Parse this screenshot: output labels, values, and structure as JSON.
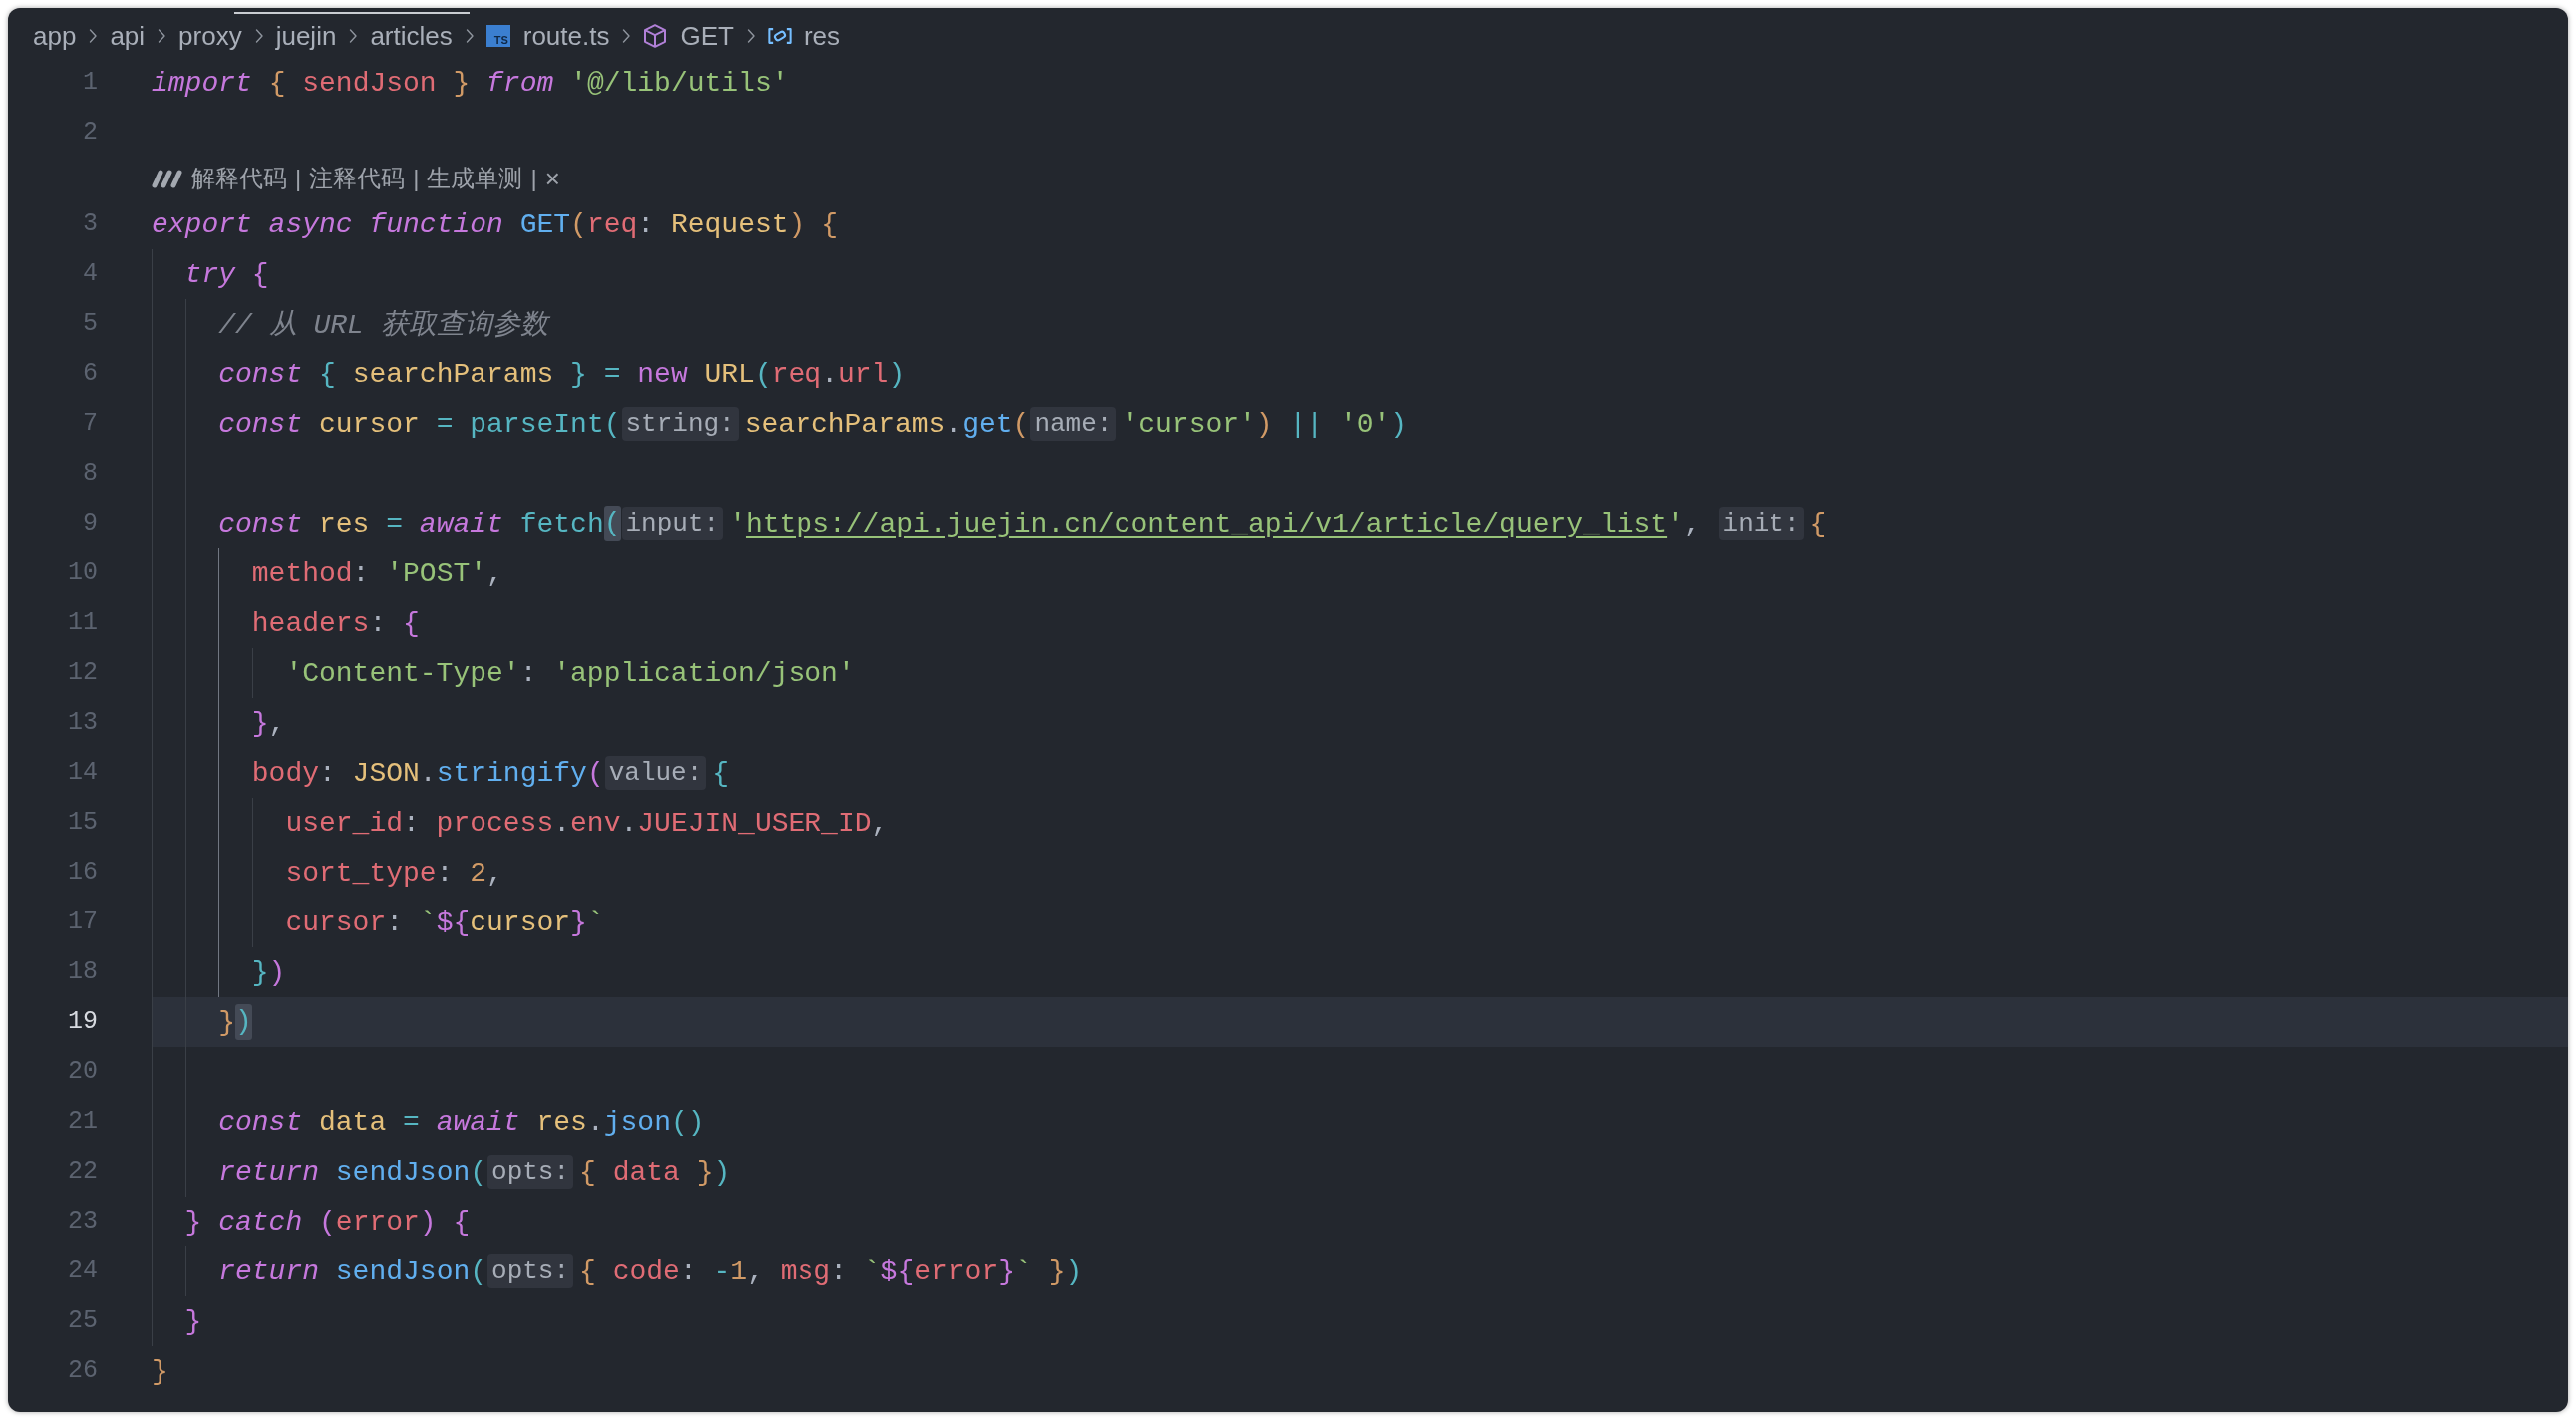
{
  "breadcrumb": [
    {
      "label": "app",
      "kind": "folder"
    },
    {
      "label": "api",
      "kind": "folder"
    },
    {
      "label": "proxy",
      "kind": "folder"
    },
    {
      "label": "juejin",
      "kind": "folder"
    },
    {
      "label": "articles",
      "kind": "folder"
    },
    {
      "label": "route.ts",
      "kind": "file",
      "icon_text": "TS"
    },
    {
      "label": "GET",
      "kind": "function"
    },
    {
      "label": "res",
      "kind": "variable"
    }
  ],
  "editor": {
    "lines": [
      {
        "kind": "code",
        "number": "1",
        "active": false,
        "tokens": [
          {
            "text": "import ",
            "kind": "keyword"
          },
          {
            "text": "{ ",
            "kind": "brace1"
          },
          {
            "text": "sendJson",
            "kind": "variable"
          },
          {
            "text": " }",
            "kind": "brace1"
          },
          {
            "text": " from ",
            "kind": "keyword"
          },
          {
            "text": "'@/lib/utils'",
            "kind": "string"
          }
        ]
      },
      {
        "kind": "code",
        "number": "2",
        "active": false
      },
      {
        "kind": "codelens",
        "items": [
          {
            "kind": "action",
            "text": "解释代码"
          },
          {
            "kind": "separator",
            "text": "|"
          },
          {
            "kind": "action",
            "text": "注释代码"
          },
          {
            "kind": "separator",
            "text": "|"
          },
          {
            "kind": "action",
            "text": "生成单测"
          },
          {
            "kind": "separator",
            "text": "|"
          },
          {
            "kind": "close",
            "text": "×"
          }
        ]
      },
      {
        "kind": "code",
        "number": "3",
        "active": false,
        "tokens": [
          {
            "text": "export async function ",
            "kind": "keyword"
          },
          {
            "text": "GET",
            "kind": "function"
          },
          {
            "text": "(",
            "kind": "brace1"
          },
          {
            "text": "req",
            "kind": "variable"
          },
          {
            "text": ": ",
            "kind": "plain"
          },
          {
            "text": "Request",
            "kind": "type"
          },
          {
            "text": ")",
            "kind": "brace1"
          },
          {
            "text": " {",
            "kind": "brace1"
          }
        ]
      },
      {
        "kind": "code",
        "number": "4",
        "active": false,
        "guides": [
          {
            "active": false
          }
        ],
        "tokens": [
          {
            "text": "try ",
            "kind": "keyword"
          },
          {
            "text": "{",
            "kind": "brace2"
          }
        ]
      },
      {
        "kind": "code",
        "number": "5",
        "active": false,
        "guides": [
          {
            "active": false
          },
          {
            "active": false
          }
        ],
        "tokens": [
          {
            "text": "// 从 URL 获取查询参数",
            "kind": "comment"
          }
        ]
      },
      {
        "kind": "code",
        "number": "6",
        "active": false,
        "guides": [
          {
            "active": false
          },
          {
            "active": false
          }
        ],
        "tokens": [
          {
            "text": "const ",
            "kind": "keyword"
          },
          {
            "text": "{ ",
            "kind": "brace3"
          },
          {
            "text": "searchParams",
            "kind": "type"
          },
          {
            "text": " }",
            "kind": "brace3"
          },
          {
            "text": " = ",
            "kind": "operator"
          },
          {
            "text": "new ",
            "kind": "storage"
          },
          {
            "text": "URL",
            "kind": "type"
          },
          {
            "text": "(",
            "kind": "brace3"
          },
          {
            "text": "req",
            "kind": "variable"
          },
          {
            "text": ".",
            "kind": "plain"
          },
          {
            "text": "url",
            "kind": "variable"
          },
          {
            "text": ")",
            "kind": "brace3"
          }
        ]
      },
      {
        "kind": "code",
        "number": "7",
        "active": false,
        "guides": [
          {
            "active": false
          },
          {
            "active": false
          }
        ],
        "tokens": [
          {
            "text": "const ",
            "kind": "keyword"
          },
          {
            "text": "cursor",
            "kind": "type"
          },
          {
            "text": " = ",
            "kind": "operator"
          },
          {
            "text": "parseInt",
            "kind": "builtin"
          },
          {
            "text": "(",
            "kind": "brace3"
          },
          {
            "text": "string:",
            "kind": "hint"
          },
          {
            "text": "searchParams",
            "kind": "type"
          },
          {
            "text": ".",
            "kind": "plain"
          },
          {
            "text": "get",
            "kind": "function"
          },
          {
            "text": "(",
            "kind": "brace1"
          },
          {
            "text": "name:",
            "kind": "hint"
          },
          {
            "text": "'cursor'",
            "kind": "string"
          },
          {
            "text": ")",
            "kind": "brace1"
          },
          {
            "text": " || ",
            "kind": "operator"
          },
          {
            "text": "'0'",
            "kind": "string"
          },
          {
            "text": ")",
            "kind": "brace3"
          }
        ]
      },
      {
        "kind": "code",
        "number": "8",
        "active": false,
        "guides": [
          {
            "active": false
          },
          {
            "active": false
          }
        ]
      },
      {
        "kind": "code",
        "number": "9",
        "active": false,
        "guides": [
          {
            "active": false
          },
          {
            "active": false
          }
        ],
        "tokens": [
          {
            "text": "const ",
            "kind": "keyword"
          },
          {
            "text": "res",
            "kind": "type"
          },
          {
            "text": " = ",
            "kind": "operator"
          },
          {
            "text": "await ",
            "kind": "keyword"
          },
          {
            "text": "fetch",
            "kind": "builtin"
          },
          {
            "text": "(",
            "kind": "match"
          },
          {
            "text": "input:",
            "kind": "hint"
          },
          {
            "text": "'",
            "kind": "string"
          },
          {
            "text": "https://api.juejin.cn/content_api/v1/article/query_list",
            "kind": "link"
          },
          {
            "text": "'",
            "kind": "string"
          },
          {
            "text": ", ",
            "kind": "plain"
          },
          {
            "text": "init:",
            "kind": "hint"
          },
          {
            "text": "{",
            "kind": "brace1"
          }
        ]
      },
      {
        "kind": "code",
        "number": "10",
        "active": false,
        "guides": [
          {
            "active": false
          },
          {
            "active": false
          },
          {
            "active": true
          }
        ],
        "tokens": [
          {
            "text": "method",
            "kind": "variable"
          },
          {
            "text": ": ",
            "kind": "plain"
          },
          {
            "text": "'POST'",
            "kind": "string"
          },
          {
            "text": ",",
            "kind": "plain"
          }
        ]
      },
      {
        "kind": "code",
        "number": "11",
        "active": false,
        "guides": [
          {
            "active": false
          },
          {
            "active": false
          },
          {
            "active": true
          }
        ],
        "tokens": [
          {
            "text": "headers",
            "kind": "variable"
          },
          {
            "text": ": ",
            "kind": "plain"
          },
          {
            "text": "{",
            "kind": "brace2"
          }
        ]
      },
      {
        "kind": "code",
        "number": "12",
        "active": false,
        "guides": [
          {
            "active": false
          },
          {
            "active": false
          },
          {
            "active": true
          },
          {
            "active": false
          }
        ],
        "tokens": [
          {
            "text": "'Content-Type'",
            "kind": "string"
          },
          {
            "text": ": ",
            "kind": "plain"
          },
          {
            "text": "'application/json'",
            "kind": "string"
          }
        ]
      },
      {
        "kind": "code",
        "number": "13",
        "active": false,
        "guides": [
          {
            "active": false
          },
          {
            "active": false
          },
          {
            "active": true
          }
        ],
        "tokens": [
          {
            "text": "}",
            "kind": "brace2"
          },
          {
            "text": ",",
            "kind": "plain"
          }
        ]
      },
      {
        "kind": "code",
        "number": "14",
        "active": false,
        "guides": [
          {
            "active": false
          },
          {
            "active": false
          },
          {
            "active": true
          }
        ],
        "tokens": [
          {
            "text": "body",
            "kind": "variable"
          },
          {
            "text": ": ",
            "kind": "plain"
          },
          {
            "text": "JSON",
            "kind": "type"
          },
          {
            "text": ".",
            "kind": "plain"
          },
          {
            "text": "stringify",
            "kind": "function"
          },
          {
            "text": "(",
            "kind": "brace2"
          },
          {
            "text": "value:",
            "kind": "hint"
          },
          {
            "text": "{",
            "kind": "brace3"
          }
        ]
      },
      {
        "kind": "code",
        "number": "15",
        "active": false,
        "guides": [
          {
            "active": false
          },
          {
            "active": false
          },
          {
            "active": true
          },
          {
            "active": false
          }
        ],
        "tokens": [
          {
            "text": "user_id",
            "kind": "variable"
          },
          {
            "text": ": ",
            "kind": "plain"
          },
          {
            "text": "process",
            "kind": "variable"
          },
          {
            "text": ".",
            "kind": "plain"
          },
          {
            "text": "env",
            "kind": "variable"
          },
          {
            "text": ".",
            "kind": "plain"
          },
          {
            "text": "JUEJIN_USER_ID",
            "kind": "variable"
          },
          {
            "text": ",",
            "kind": "plain"
          }
        ]
      },
      {
        "kind": "code",
        "number": "16",
        "active": false,
        "guides": [
          {
            "active": false
          },
          {
            "active": false
          },
          {
            "active": true
          },
          {
            "active": false
          }
        ],
        "tokens": [
          {
            "text": "sort_type",
            "kind": "variable"
          },
          {
            "text": ": ",
            "kind": "plain"
          },
          {
            "text": "2",
            "kind": "number"
          },
          {
            "text": ",",
            "kind": "plain"
          }
        ]
      },
      {
        "kind": "code",
        "number": "17",
        "active": false,
        "guides": [
          {
            "active": false
          },
          {
            "active": false
          },
          {
            "active": true
          },
          {
            "active": false
          }
        ],
        "tokens": [
          {
            "text": "cursor",
            "kind": "variable"
          },
          {
            "text": ": ",
            "kind": "plain"
          },
          {
            "text": "`",
            "kind": "string"
          },
          {
            "text": "${",
            "kind": "interp"
          },
          {
            "text": "cursor",
            "kind": "type"
          },
          {
            "text": "}",
            "kind": "interp"
          },
          {
            "text": "`",
            "kind": "string"
          }
        ]
      },
      {
        "kind": "code",
        "number": "18",
        "active": false,
        "guides": [
          {
            "active": false
          },
          {
            "active": false
          },
          {
            "active": true
          }
        ],
        "tokens": [
          {
            "text": "}",
            "kind": "brace3"
          },
          {
            "text": ")",
            "kind": "brace2"
          }
        ]
      },
      {
        "kind": "code",
        "number": "19",
        "active": true,
        "guides": [
          {
            "active": false
          },
          {
            "active": false
          }
        ],
        "tokens": [
          {
            "text": "}",
            "kind": "brace1"
          },
          {
            "text": ")",
            "kind": "match"
          }
        ]
      },
      {
        "kind": "code",
        "number": "20",
        "active": false,
        "guides": [
          {
            "active": false
          },
          {
            "active": false
          }
        ]
      },
      {
        "kind": "code",
        "number": "21",
        "active": false,
        "guides": [
          {
            "active": false
          },
          {
            "active": false
          }
        ],
        "tokens": [
          {
            "text": "const ",
            "kind": "keyword"
          },
          {
            "text": "data",
            "kind": "type"
          },
          {
            "text": " = ",
            "kind": "operator"
          },
          {
            "text": "await ",
            "kind": "keyword"
          },
          {
            "text": "res",
            "kind": "type"
          },
          {
            "text": ".",
            "kind": "plain"
          },
          {
            "text": "json",
            "kind": "function"
          },
          {
            "text": "()",
            "kind": "brace3"
          }
        ]
      },
      {
        "kind": "code",
        "number": "22",
        "active": false,
        "guides": [
          {
            "active": false
          },
          {
            "active": false
          }
        ],
        "tokens": [
          {
            "text": "return ",
            "kind": "keyword"
          },
          {
            "text": "sendJson",
            "kind": "function"
          },
          {
            "text": "(",
            "kind": "brace3"
          },
          {
            "text": "opts:",
            "kind": "hint"
          },
          {
            "text": "{ ",
            "kind": "brace1"
          },
          {
            "text": "data",
            "kind": "variable"
          },
          {
            "text": " }",
            "kind": "brace1"
          },
          {
            "text": ")",
            "kind": "brace3"
          }
        ]
      },
      {
        "kind": "code",
        "number": "23",
        "active": false,
        "guides": [
          {
            "active": false
          }
        ],
        "tokens": [
          {
            "text": "} ",
            "kind": "brace2"
          },
          {
            "text": "catch ",
            "kind": "keyword"
          },
          {
            "text": "(",
            "kind": "brace2"
          },
          {
            "text": "error",
            "kind": "variable"
          },
          {
            "text": ")",
            "kind": "brace2"
          },
          {
            "text": " {",
            "kind": "brace2"
          }
        ]
      },
      {
        "kind": "code",
        "number": "24",
        "active": false,
        "guides": [
          {
            "active": false
          },
          {
            "active": false
          }
        ],
        "tokens": [
          {
            "text": "return ",
            "kind": "keyword"
          },
          {
            "text": "sendJson",
            "kind": "function"
          },
          {
            "text": "(",
            "kind": "brace3"
          },
          {
            "text": "opts:",
            "kind": "hint"
          },
          {
            "text": "{ ",
            "kind": "brace1"
          },
          {
            "text": "code",
            "kind": "variable"
          },
          {
            "text": ": ",
            "kind": "plain"
          },
          {
            "text": "-",
            "kind": "operator"
          },
          {
            "text": "1",
            "kind": "number"
          },
          {
            "text": ", ",
            "kind": "plain"
          },
          {
            "text": "msg",
            "kind": "variable"
          },
          {
            "text": ": ",
            "kind": "plain"
          },
          {
            "text": "`",
            "kind": "string"
          },
          {
            "text": "${",
            "kind": "interp"
          },
          {
            "text": "error",
            "kind": "variable"
          },
          {
            "text": "}",
            "kind": "interp"
          },
          {
            "text": "`",
            "kind": "string"
          },
          {
            "text": " }",
            "kind": "brace1"
          },
          {
            "text": ")",
            "kind": "brace3"
          }
        ]
      },
      {
        "kind": "code",
        "number": "25",
        "active": false,
        "guides": [
          {
            "active": false
          }
        ],
        "tokens": [
          {
            "text": "}",
            "kind": "brace2"
          }
        ]
      },
      {
        "kind": "code",
        "number": "26",
        "active": false,
        "tokens": [
          {
            "text": "}",
            "kind": "brace1"
          }
        ]
      }
    ]
  }
}
